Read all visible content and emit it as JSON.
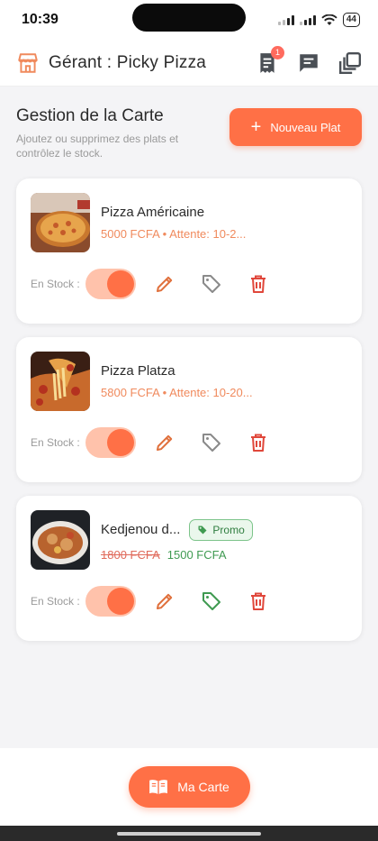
{
  "status": {
    "time": "10:39",
    "battery": "44"
  },
  "header": {
    "title": "Gérant : Picky Pizza",
    "notif_count": "1"
  },
  "section": {
    "title": "Gestion de la Carte",
    "subtitle": "Ajoutez ou supprimez des plats et contrôlez le stock.",
    "new_button_label": "Nouveau Plat"
  },
  "stock_label": "En Stock :",
  "dishes": [
    {
      "name": "Pizza Américaine",
      "meta": "5000 FCFA • Attente: 10-2...",
      "in_stock": true,
      "promo": false
    },
    {
      "name": "Pizza Platza",
      "meta": "5800 FCFA • Attente: 10-20...",
      "in_stock": true,
      "promo": false
    },
    {
      "name": "Kedjenou d...",
      "old_price": "1800 FCFA",
      "new_price": "1500 FCFA",
      "promo_label": "Promo",
      "in_stock": true,
      "promo": true
    }
  ],
  "bottom": {
    "menu_button_label": "Ma Carte"
  },
  "colors": {
    "accent": "#ff7046",
    "promo_green": "#3f9a51",
    "delete_red": "#e0473b"
  }
}
